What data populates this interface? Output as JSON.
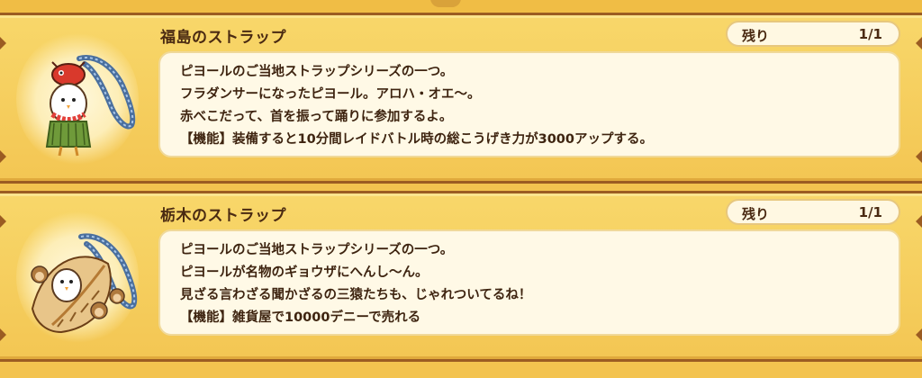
{
  "items": [
    {
      "name": "福島のストラップ",
      "remaining_label": "残り",
      "remaining_value": "1/1",
      "icon": "fukushima-strap-icon",
      "lines": [
        "ピヨールのご当地ストラップシリーズの一つ。",
        "フラダンサーになったピヨール。アロハ・オエ〜。",
        "赤べこだって、首を振って踊りに参加するよ。",
        "【機能】装備すると10分間レイドバトル時の総こうげき力が3000アップする。"
      ]
    },
    {
      "name": "栃木のストラップ",
      "remaining_label": "残り",
      "remaining_value": "1/1",
      "icon": "tochigi-strap-icon",
      "lines": [
        "ピヨールのご当地ストラップシリーズの一つ。",
        "ピヨールが名物のギョウザにへんし〜ん。",
        "見ざる言わざる聞かざるの三猿たちも、じゃれついてるね！",
        "【機能】雑貨屋で10000デニーで売れる"
      ]
    }
  ]
}
